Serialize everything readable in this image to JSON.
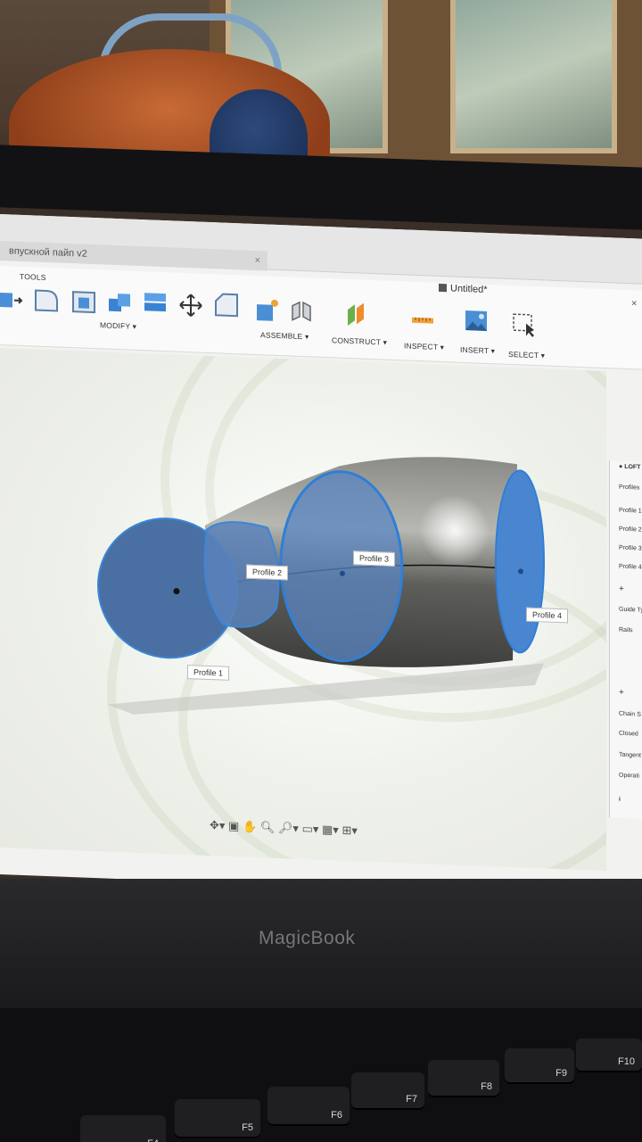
{
  "document_tab": {
    "name": "впускной пайп v2",
    "close": "×"
  },
  "window": {
    "title": "Untitled*",
    "close": "×"
  },
  "toolbar": {
    "tools_label": "TOOLS",
    "groups": [
      "MODIFY ▾",
      "ASSEMBLE ▾",
      "CONSTRUCT ▾",
      "INSPECT ▾",
      "INSERT ▾",
      "SELECT ▾"
    ]
  },
  "profiles": [
    "Profile 1",
    "Profile 2",
    "Profile 3",
    "Profile 4"
  ],
  "loft_panel": {
    "title": "LOFT",
    "profiles_header": "Profiles",
    "profile_rows": [
      "Profile 1",
      "Profile 2",
      "Profile 3",
      "Profile 4"
    ],
    "add": "+",
    "guide_type": "Guide Ty",
    "rails": "Rails",
    "add2": "+",
    "chain": "Chain S",
    "closed": "Closed",
    "tangent": "Tangent",
    "operation": "Operati",
    "info": "i"
  },
  "navbar": {
    "icons": [
      "orbit-icon",
      "look-at-icon",
      "pan-icon",
      "zoom-icon",
      "zoom-window-icon",
      "display-settings-icon",
      "grid-icon",
      "viewports-icon"
    ]
  },
  "laptop": {
    "brand": "MagicBook"
  },
  "keys": [
    {
      "label": "F4"
    },
    {
      "label": "F5"
    },
    {
      "label": "F6"
    },
    {
      "label": "F7"
    },
    {
      "label": "F8"
    },
    {
      "label": "F9"
    },
    {
      "label": "F10"
    }
  ],
  "colors": {
    "profile_blue": "#4a86d0",
    "body_gray": "#6a6a68",
    "panel_bg": "#f7f7f7"
  }
}
